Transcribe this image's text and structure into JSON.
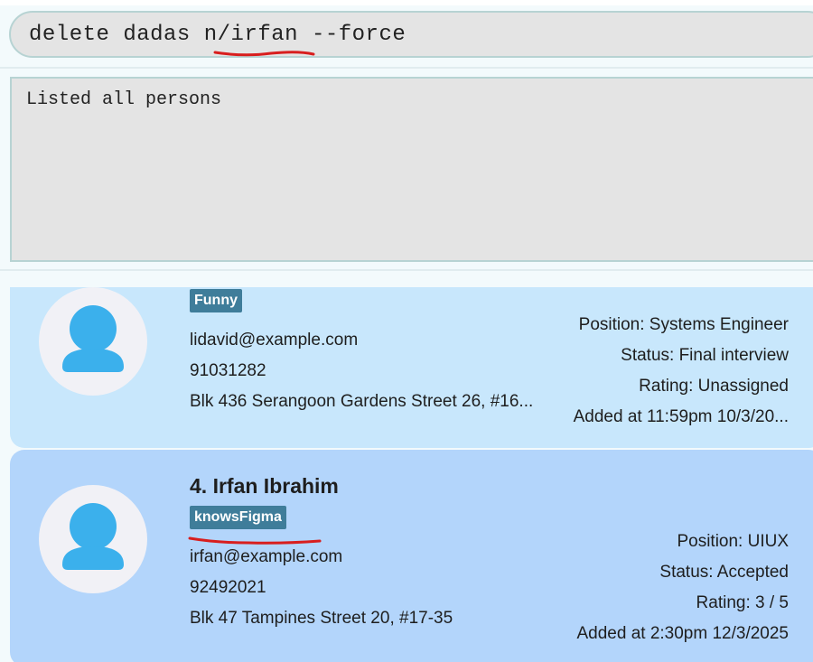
{
  "command": {
    "text": "delete dadas n/irfan --force"
  },
  "result": {
    "text": "Listed all persons"
  },
  "persons": [
    {
      "name": "",
      "tag": "Funny",
      "email": "lidavid@example.com",
      "phone": "91031282",
      "address": "Blk 436 Serangoon Gardens Street 26, #16...",
      "position": "Position:  Systems Engineer",
      "status": "Status:  Final interview",
      "rating": "Rating:  Unassigned",
      "added": "Added at 11:59pm 10/3/20..."
    },
    {
      "name": "4. Irfan Ibrahim",
      "tag": "knowsFigma",
      "email": "irfan@example.com",
      "phone": "92492021",
      "address": "Blk 47 Tampines Street 20, #17-35",
      "position": "Position:  UIUX",
      "status": "Status:  Accepted",
      "rating": "Rating:  3 / 5",
      "added": "Added at 2:30pm 12/3/2025"
    }
  ],
  "colors": {
    "annotation": "#d81e1e",
    "tag_bg": "#3f7d9a",
    "card_1_bg": "#c8e7fc",
    "card_2_bg": "#b3d5fb",
    "avatar_icon": "#3bb0ec"
  },
  "icons": {
    "avatar": "person-avatar-icon"
  }
}
